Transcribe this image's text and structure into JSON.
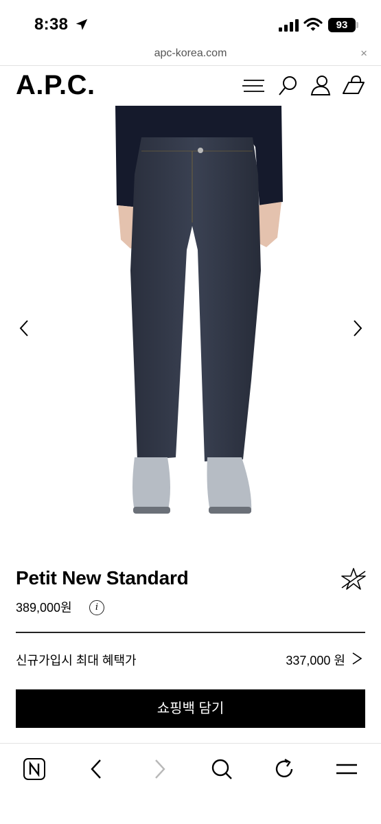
{
  "status_bar": {
    "time": "8:38",
    "battery": "93"
  },
  "browser": {
    "url": "apc-korea.com",
    "close_glyph": "×"
  },
  "site": {
    "logo": "A.P.C."
  },
  "product": {
    "name": "Petit New Standard",
    "price": "389,000원",
    "info_glyph": "i",
    "member_label": "신규가입시 최대 혜택가",
    "member_price": "337,000 원",
    "cart_button": "쇼핑백 담기"
  },
  "icons": {
    "status": [
      "location-arrow-icon",
      "signal-icon",
      "wifi-icon",
      "battery-icon"
    ],
    "header": [
      "menu-icon",
      "search-icon",
      "account-icon",
      "bag-icon"
    ],
    "product": [
      "favorite-star-icon",
      "info-icon",
      "chevron-right-icon"
    ],
    "carousel": [
      "chevron-left-icon",
      "chevron-right-icon"
    ],
    "toolbar": [
      "naver-home-icon",
      "back-icon",
      "forward-icon",
      "search-icon",
      "reload-icon",
      "menu-icon"
    ]
  }
}
